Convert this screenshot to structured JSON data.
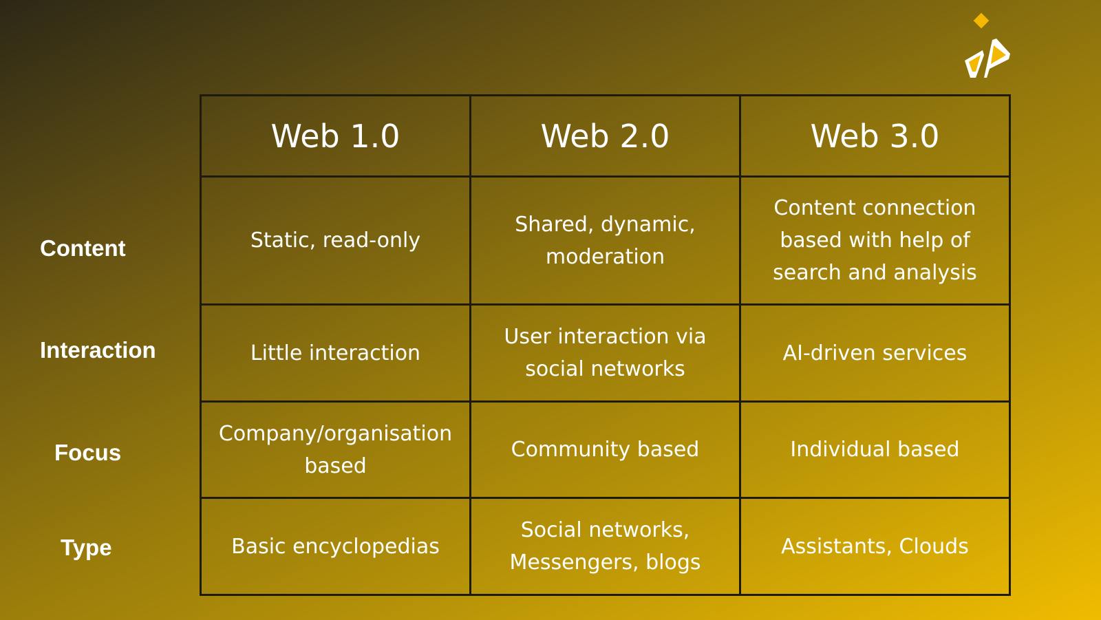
{
  "columns": [
    "Web 1.0",
    "Web 2.0",
    "Web 3.0"
  ],
  "rows": [
    {
      "label": "Content",
      "cells": [
        "Static, read-only",
        "Shared, dynamic, moderation",
        "Content connection based with help of search and analysis"
      ]
    },
    {
      "label": "Interaction",
      "cells": [
        "Little interaction",
        "User interaction via social networks",
        "AI-driven services"
      ]
    },
    {
      "label": "Focus",
      "cells": [
        "Company/organisation based",
        "Community based",
        "Individual based"
      ]
    },
    {
      "label": "Type",
      "cells": [
        "Basic encyclopedias",
        "Social networks, Messengers, blogs",
        "Assistants, Clouds"
      ]
    }
  ],
  "colors": {
    "accent": "#f5b800",
    "border": "#1e1a0c",
    "text": "#ffffff"
  },
  "logo": {
    "icon": "brand-logo-icon"
  }
}
